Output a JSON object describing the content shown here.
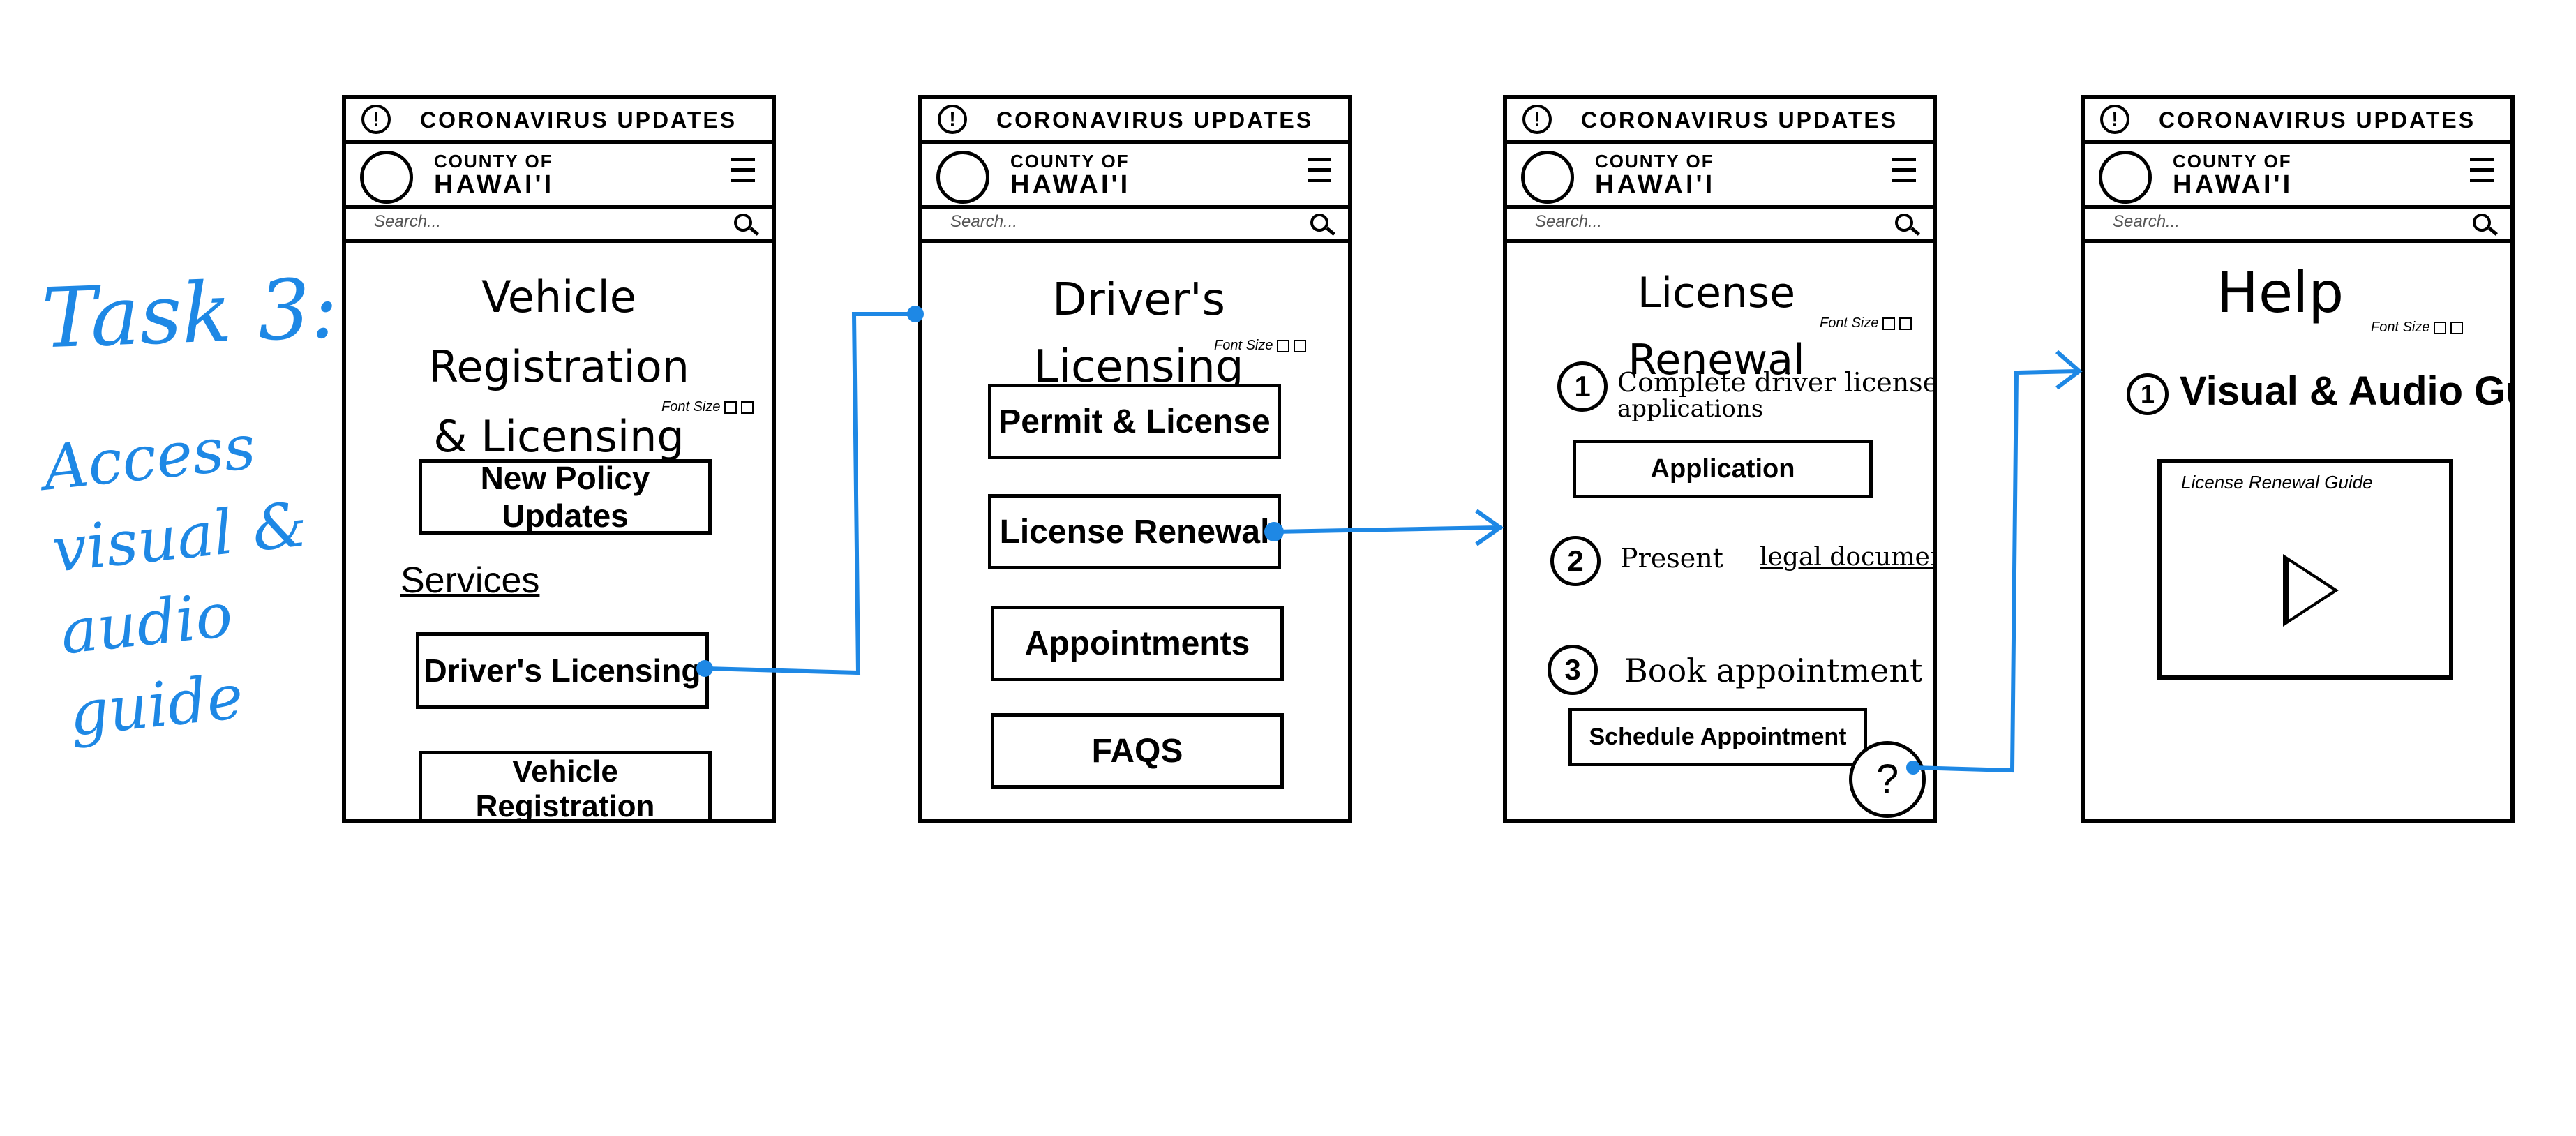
{
  "task": {
    "title": "Task 3:",
    "description": "Access visual & audio guide"
  },
  "common": {
    "banner_text": "CORONAVIRUS UPDATES",
    "county_top": "COUNTY OF",
    "county_name": "HAWAI'I",
    "search_placeholder": "Search...",
    "font_size_label": "Font Size"
  },
  "screen1": {
    "title_line1": "Vehicle Registration",
    "title_line2": "& Licensing Division",
    "policy_button": "New Policy Updates",
    "services_heading": "Services",
    "drivers_licensing_button": "Driver's Licensing",
    "vehicle_registration_button": "Vehicle Registration"
  },
  "screen2": {
    "title": "Driver's Licensing",
    "buttons": [
      "Permit & License",
      "License Renewal",
      "Appointments",
      "FAQS"
    ]
  },
  "screen3": {
    "title": "License Renewal",
    "steps": [
      {
        "num": "1",
        "label": "Complete driver license",
        "label2": "applications"
      },
      {
        "num": "2",
        "label": "Present",
        "link": "legal documents"
      },
      {
        "num": "3",
        "label": "Book appointment"
      }
    ],
    "application_button": "Application",
    "schedule_button": "Schedule Appointment",
    "help_button": "?"
  },
  "screen4": {
    "title": "Help",
    "guide_number": "1",
    "guide_heading": "Visual & Audio Guide",
    "video_title": "License Renewal Guide"
  },
  "colors": {
    "flow_arrow": "#1e88e5",
    "ink": "#000000"
  }
}
